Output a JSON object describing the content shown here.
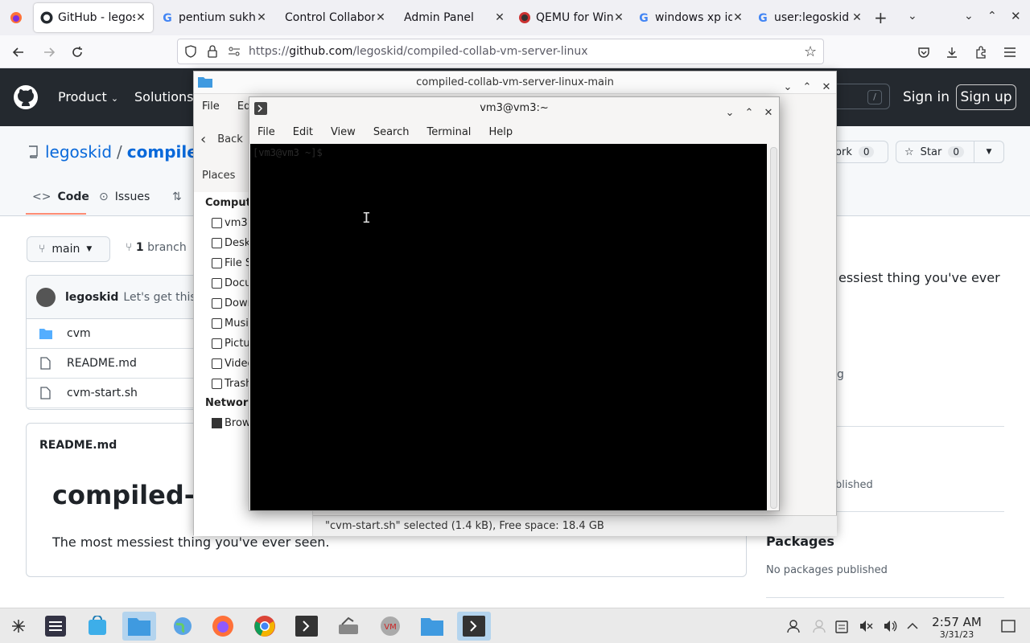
{
  "browser": {
    "tabs": [
      {
        "label": "GitHub - legoskid",
        "icon": "github-icon"
      },
      {
        "label": "pentium sukhoi",
        "icon": "google-icon"
      },
      {
        "label": "Control Collaborat",
        "icon": "none"
      },
      {
        "label": "Admin Panel",
        "icon": "none"
      },
      {
        "label": "QEMU for Windows",
        "icon": "qemu-icon"
      },
      {
        "label": "windows xp id",
        "icon": "google-icon"
      },
      {
        "label": "user:legoskid",
        "icon": "google-icon"
      }
    ],
    "url_prefix": "https://",
    "url_domain": "github.com",
    "url_path": "/legoskid/compiled-collab-vm-server-linux"
  },
  "github": {
    "nav": {
      "product": "Product",
      "solutions": "Solutions",
      "search_key": "/",
      "sign_in": "Sign in",
      "sign_up": "Sign up"
    },
    "owner": "legoskid",
    "sep": "/",
    "repo": "compiled",
    "fork_label": "Fork",
    "fork_count": "0",
    "star_label": "Star",
    "star_count": "0",
    "tabs": {
      "code": "Code",
      "issues": "Issues"
    },
    "branch": "main",
    "branch_count": "1",
    "branch_word": "branch",
    "commit_author": "legoskid",
    "commit_msg": "Let's get this in",
    "files": [
      {
        "name": "cvm",
        "type": "folder"
      },
      {
        "name": "README.md",
        "type": "file"
      },
      {
        "name": "cvm-start.sh",
        "type": "file"
      }
    ],
    "readme_label": "README.md",
    "readme_heading": "compiled-c",
    "readme_text": "The most messiest thing you've ever seen.",
    "about_text": "essiest thing you've ever",
    "about_fragment": "g",
    "about_unpublished": "blished",
    "packages_heading": "Packages",
    "packages_text": "No packages published"
  },
  "filemanager": {
    "title": "compiled-collab-vm-server-linux-main",
    "menu_file": "File",
    "menu_edit": "Edi",
    "back": "Back",
    "places": "Places",
    "sec_computer": "Comput",
    "items": [
      "vm3",
      "Desk",
      "File S",
      "Docu",
      "Down",
      "Musi",
      "Pictu",
      "Video",
      "Trash"
    ],
    "sec_network": "Network",
    "network_item": "Brow",
    "status": "\"cvm-start.sh\" selected (1.4 kB), Free space: 18.4 GB"
  },
  "terminal": {
    "title": "vm3@vm3:~",
    "menu": [
      "File",
      "Edit",
      "View",
      "Search",
      "Terminal",
      "Help"
    ],
    "prompt": "[vm3@vm3 ~]$"
  },
  "taskbar": {
    "time": "2:57 AM",
    "date": "3/31/23"
  }
}
